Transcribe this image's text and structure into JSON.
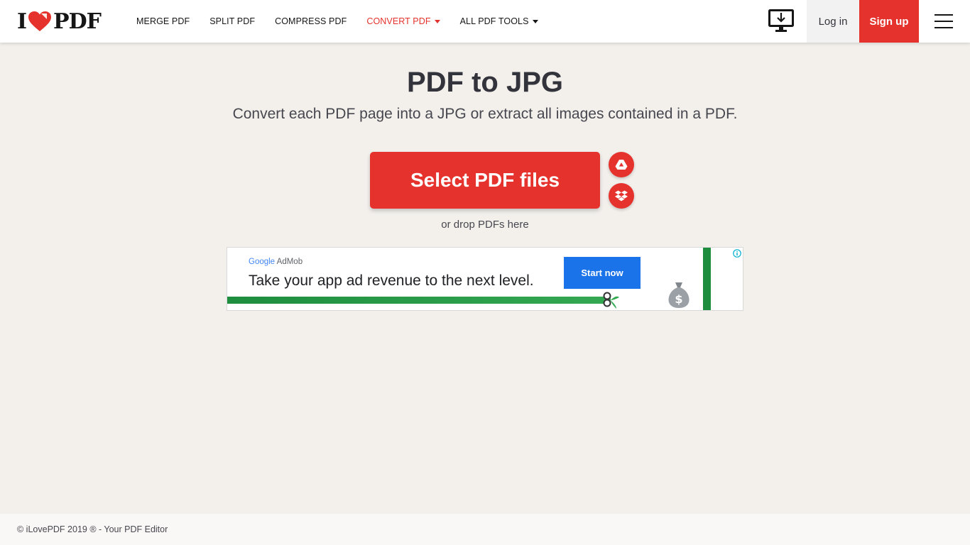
{
  "header": {
    "logo_left": "I",
    "logo_right": "PDF",
    "nav": [
      {
        "label": "MERGE PDF"
      },
      {
        "label": "SPLIT PDF"
      },
      {
        "label": "COMPRESS PDF"
      },
      {
        "label": "CONVERT PDF"
      },
      {
        "label": "ALL PDF TOOLS"
      }
    ],
    "login": "Log in",
    "signup": "Sign up"
  },
  "main": {
    "title": "PDF to JPG",
    "subtitle": "Convert each PDF page into a JPG or extract all images contained in a PDF.",
    "select_button": "Select PDF files",
    "drop_hint": "or drop PDFs here"
  },
  "ad": {
    "brand_google": "Google",
    "brand_product": "AdMob",
    "headline": "Take your app ad revenue to the next level.",
    "cta": "Start now"
  },
  "footer": {
    "copyright": "© iLovePDF 2019 ® - Your PDF Editor"
  },
  "colors": {
    "brand_red": "#e5322d",
    "background": "#f3f0ec",
    "text": "#33333b",
    "ad_blue": "#1a73e8",
    "ad_green": "#1e8e3e"
  },
  "icons": [
    "heart-logo-icon",
    "caret-down-icon",
    "desktop-download-icon",
    "hamburger-menu-icon",
    "google-drive-icon",
    "dropbox-icon",
    "money-bag-icon",
    "ad-info-icon"
  ]
}
